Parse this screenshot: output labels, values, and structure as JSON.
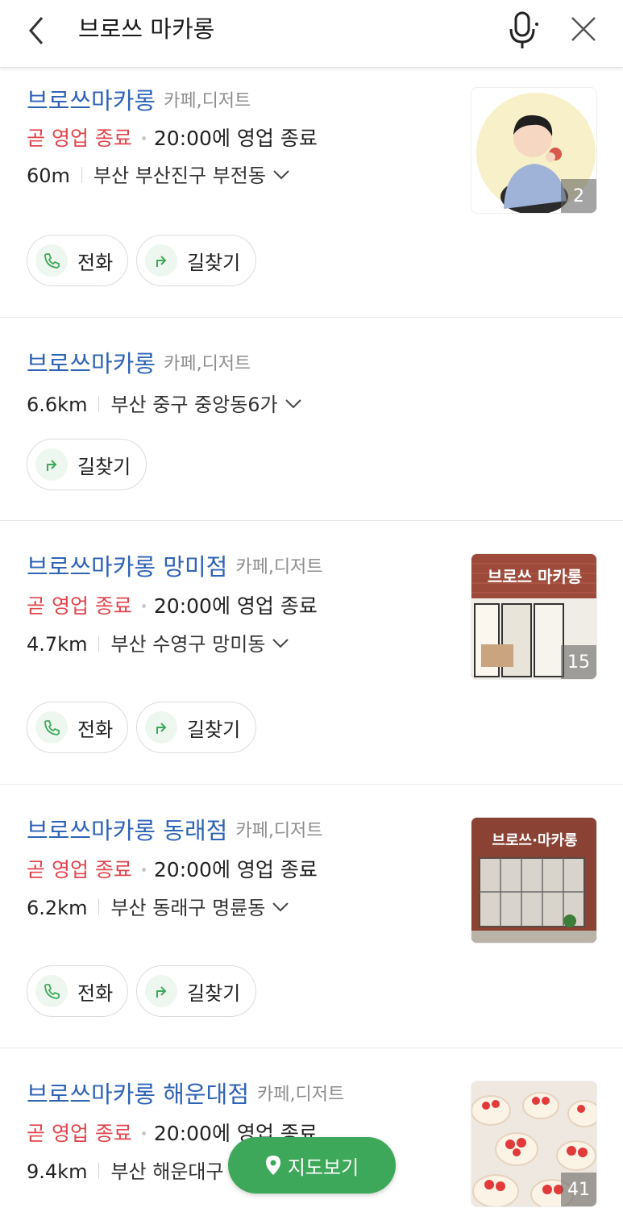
{
  "search": {
    "query": "브로쓰 마카롱"
  },
  "icons": {
    "back": "chevron-left-icon",
    "mic": "microphone-icon",
    "close": "close-icon",
    "phone": "phone-icon",
    "directions": "directions-icon",
    "pin": "map-pin-icon"
  },
  "colors": {
    "name": "#2e63b5",
    "status": "#e0454d",
    "accent": "#3ea85a"
  },
  "results": [
    {
      "name": "브로쓰마카롱",
      "category": "카페,디저트",
      "status": "곧 영업 종료",
      "hours": "20:00에 영업 종료",
      "distance": "60m",
      "address": "부산 부산진구 부전동",
      "call_label": "전화",
      "directions_label": "길찾기",
      "photo_count": "2"
    },
    {
      "name": "브로쓰마카롱",
      "category": "카페,디저트",
      "distance": "6.6km",
      "address": "부산 중구 중앙동6가",
      "directions_label": "길찾기"
    },
    {
      "name": "브로쓰마카롱 망미점",
      "category": "카페,디저트",
      "status": "곧 영업 종료",
      "hours": "20:00에 영업 종료",
      "distance": "4.7km",
      "address": "부산 수영구 망미동",
      "call_label": "전화",
      "directions_label": "길찾기",
      "photo_count": "15",
      "sign_text": "브로쓰 마카롱"
    },
    {
      "name": "브로쓰마카롱 동래점",
      "category": "카페,디저트",
      "status": "곧 영업 종료",
      "hours": "20:00에 영업 종료",
      "distance": "6.2km",
      "address": "부산 동래구 명륜동",
      "call_label": "전화",
      "directions_label": "길찾기",
      "sign_text": "브로쓰·마카롱"
    },
    {
      "name": "브로쓰마카롱 해운대점",
      "category": "카페,디저트",
      "status": "곧 영업 종료",
      "hours": "20:00에 영업 종료",
      "distance": "9.4km",
      "address": "부산 해운대구",
      "photo_count": "41"
    }
  ],
  "map_button": {
    "label": "지도보기"
  }
}
